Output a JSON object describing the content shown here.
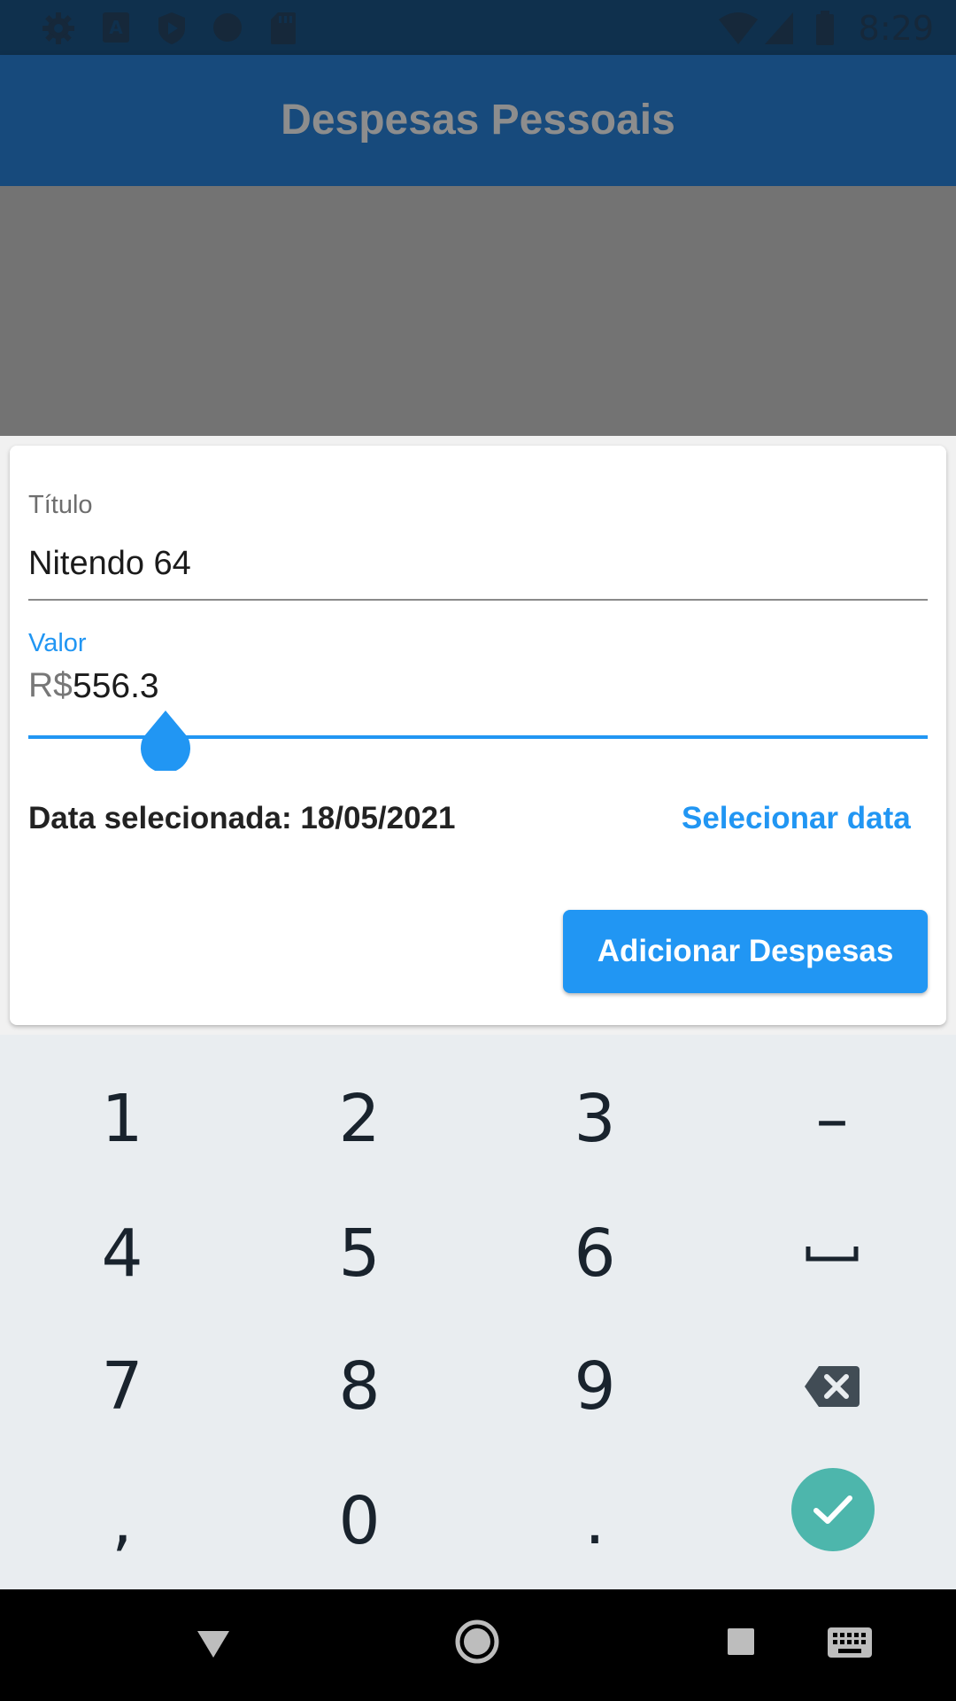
{
  "status_bar": {
    "time": "8:29",
    "icons": [
      "settings-icon",
      "font-download-icon",
      "play-protect-icon",
      "circle-icon",
      "sd-card-icon",
      "wifi-icon",
      "signal-icon",
      "battery-icon"
    ]
  },
  "app_bar": {
    "title": "Despesas Pessoais"
  },
  "form": {
    "titulo": {
      "label": "Título",
      "value": "Nitendo 64"
    },
    "valor": {
      "label": "Valor",
      "prefix": "R$",
      "value": "556.3"
    },
    "date_text": "Data selecionada: 18/05/2021",
    "select_date_label": "Selecionar data",
    "submit_label": "Adicionar Despesas"
  },
  "keyboard": {
    "keys": [
      "1",
      "2",
      "3",
      "–",
      "4",
      "5",
      "6",
      "␣",
      "7",
      "8",
      "9",
      "backspace",
      ",",
      "0",
      ".",
      "done"
    ],
    "row1": [
      "1",
      "2",
      "3",
      "–"
    ],
    "row2": [
      "4",
      "5",
      "6"
    ],
    "row3": [
      "7",
      "8",
      "9"
    ],
    "row4": [
      ",",
      "0",
      "."
    ],
    "accent_color": "#4db6ac"
  },
  "nav_bar": {
    "buttons": [
      "back-icon",
      "home-icon",
      "recents-icon",
      "keyboard-switch-icon"
    ]
  },
  "colors": {
    "primary": "#2196f3",
    "app_bar": "#174a7c",
    "status_bar": "#0f304d"
  }
}
